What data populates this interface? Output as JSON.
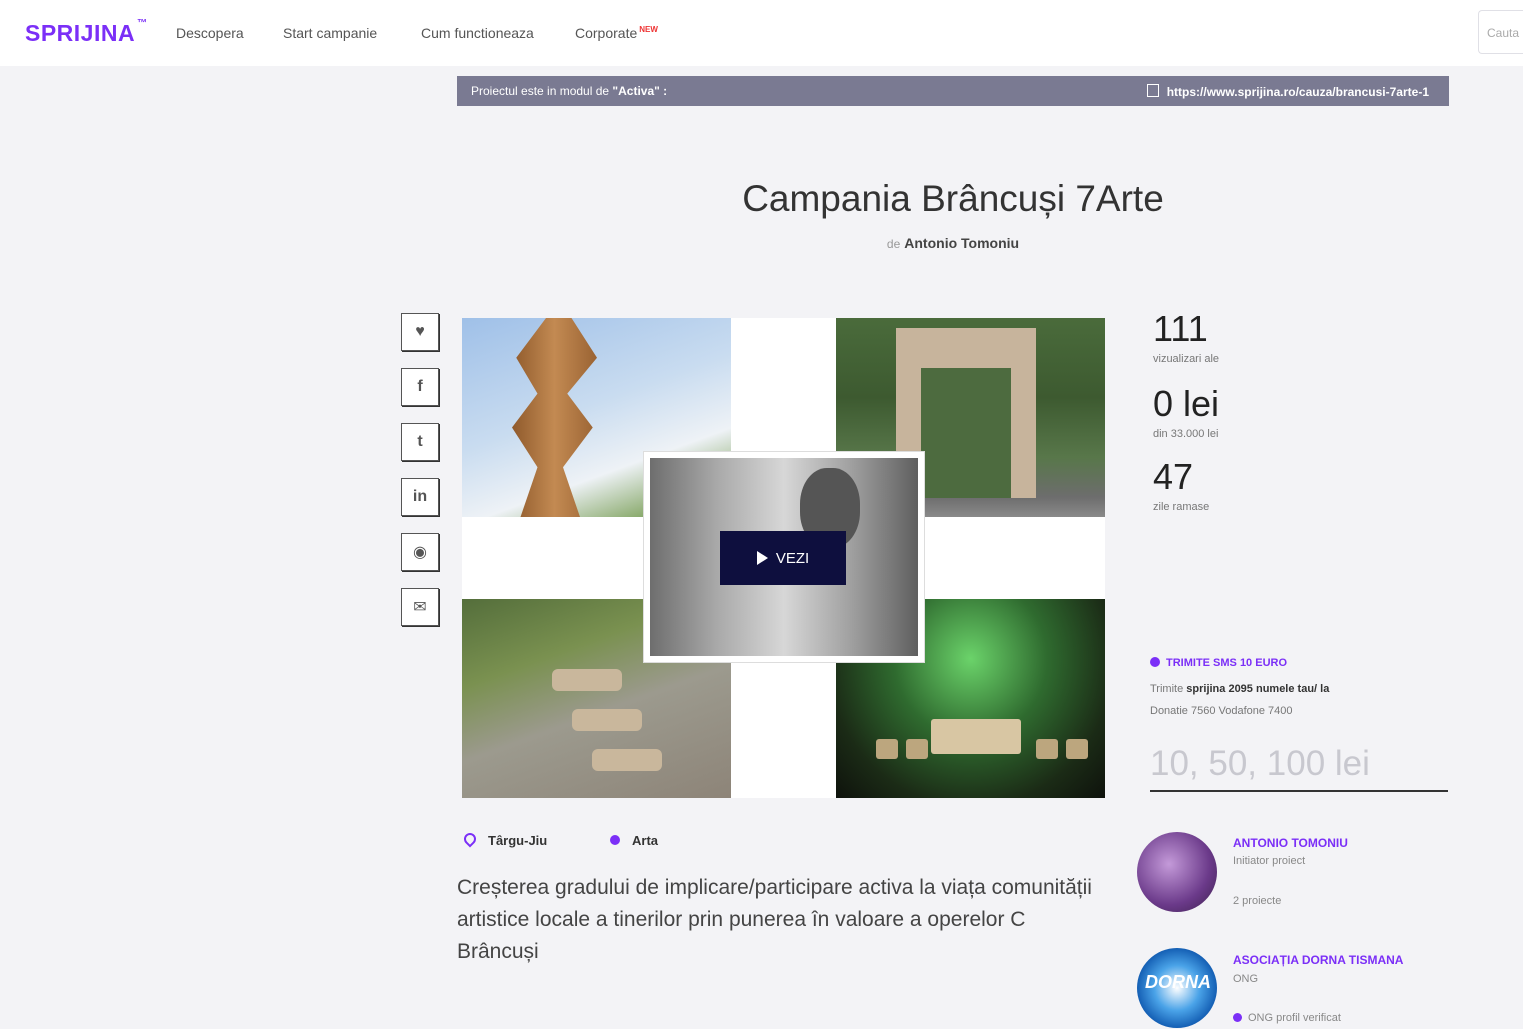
{
  "nav": {
    "logo": "SPRIJINA",
    "logo_mark": "™",
    "links": [
      {
        "label": "Descopera"
      },
      {
        "label": "Start campanie"
      },
      {
        "label": "Cum functioneaza"
      },
      {
        "label": "Corporate",
        "badge": "NEW"
      }
    ],
    "search_placeholder": "Cauta"
  },
  "banner": {
    "status_prefix": "Proiectul este in modul de ",
    "status_value": "\"Activa\" :",
    "url": "https://www.sprijina.ro/cauza/brancusi-7arte-1"
  },
  "campaign": {
    "title": "Campania Brâncuși 7Arte",
    "by_label": "de",
    "author": "Antonio Tomoniu"
  },
  "media": {
    "play_label": "VEZI"
  },
  "share": [
    {
      "icon": "heart-icon",
      "glyph": "♥"
    },
    {
      "icon": "facebook-icon",
      "glyph": "f"
    },
    {
      "icon": "twitter-icon",
      "glyph": "t"
    },
    {
      "icon": "linkedin-icon",
      "glyph": "in"
    },
    {
      "icon": "whatsapp-icon",
      "glyph": "◉"
    },
    {
      "icon": "email-icon",
      "glyph": "✉"
    }
  ],
  "stats": {
    "views": "111",
    "views_label": "vizualizari  ale",
    "raised": "0 lei",
    "raised_label": "din 33.000 lei",
    "days": "47",
    "days_label": "zile ramase"
  },
  "sms": {
    "title": "TRIMITE SMS 10 EURO",
    "line1_prefix": "Trimite ",
    "line1_keyword": "sprijina  2095  numele tau/ la",
    "line2": "Donatie 7560 Vodafone 7400"
  },
  "donation": {
    "placeholder": "10, 50, 100 lei"
  },
  "meta": {
    "location": "Târgu-Jiu",
    "category": "Arta"
  },
  "description": "Creșterea gradului de implicare/participare activa la viața comunității artistice locale a tinerilor prin punerea în valoare a operelor C Brâncuși",
  "people": [
    {
      "name": "ANTONIO TOMONIU",
      "role": "Initiator proiect",
      "extra": "2 proiecte"
    },
    {
      "name": "ASOCIAȚIA DORNA TISMANA",
      "role": "ONG",
      "extra": "ONG profil verificat"
    }
  ],
  "colors": {
    "accent": "#7b2ff7",
    "banner": "#7a7a92",
    "play_button": "#0e0f3e"
  }
}
